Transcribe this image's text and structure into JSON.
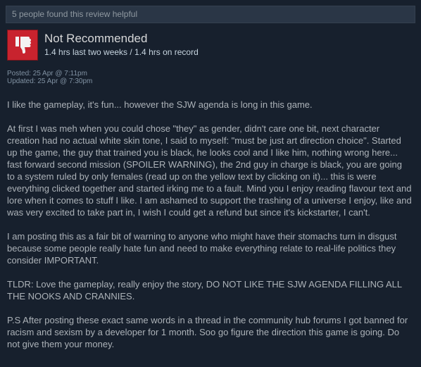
{
  "review": {
    "helpful_text": "5 people found this review helpful",
    "thumb_icon": "thumbs-down-icon",
    "verdict": "Not Recommended",
    "hours": "1.4 hrs last two weeks / 1.4 hrs on record",
    "posted": "Posted: 25 Apr @ 7:11pm",
    "updated": "Updated: 25 Apr @ 7:30pm",
    "paragraphs": [
      "I like the gameplay, it's fun... however the SJW agenda is long in this game.",
      "At first I was meh when you could chose \"they\" as gender, didn't care one bit, next character creation had no actual white skin tone, I said to myself: \"must be just art direction choice\". Started up the game, the guy that trained you is black, he looks cool and I like him, nothing wrong here... fast forward second mission (SPOILER WARNING), the 2nd guy in charge is black, you are going to a system ruled by only females (read up on the yellow text by clicking on it)... this is were everything clicked together and started irking me to a fault. Mind you I enjoy reading flavour text and lore when it comes to stuff I like. I am ashamed to support the trashing of a universe I enjoy, like and was very excited to take part in, I wish I could get a refund but since it's kickstarter, I can't.",
      "I am posting this as a fair bit of warning to anyone who might have their stomachs turn in disgust because some people really hate fun and need to make everything relate to real-life politics they consider IMPORTANT.",
      "TLDR: Love the gameplay, really enjoy the story, DO NOT LIKE THE SJW AGENDA FILLING ALL THE NOOKS AND CRANNIES.",
      "P.S After posting these exact same words in a thread in the community hub forums I got banned for racism and sexism by a developer for 1 month. Soo go figure the direction this game is going. Do not give them your money."
    ]
  }
}
